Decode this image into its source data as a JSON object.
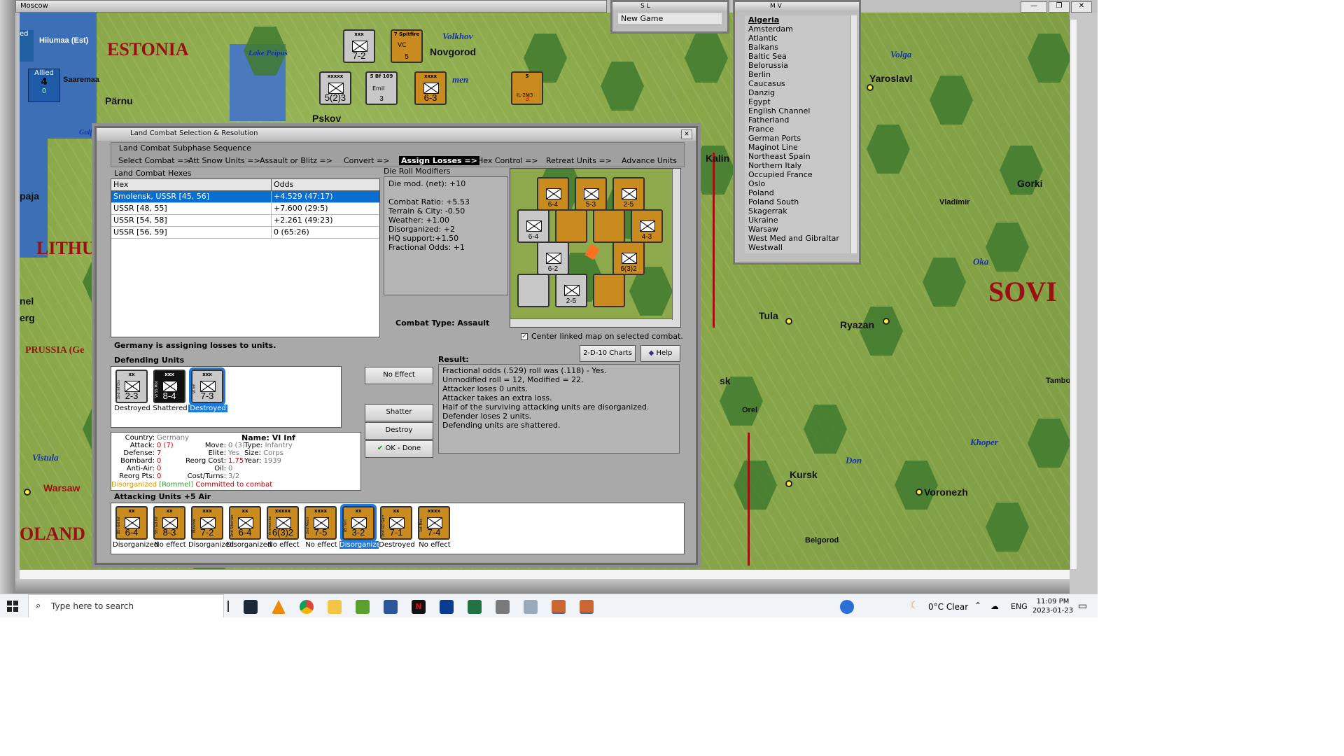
{
  "window": {
    "title": "Moscow"
  },
  "sl_window": {
    "title": "S L",
    "new_game": "New Game"
  },
  "mv_window": {
    "title": "M V",
    "items": [
      "Algeria",
      "Amsterdam",
      "Atlantic",
      "Balkans",
      "Baltic Sea",
      "Belorussia",
      "Berlin",
      "Caucasus",
      "Danzig",
      "Egypt",
      "English Channel",
      "Fatherland",
      "France",
      "German Ports",
      "Maginot Line",
      "Northeast Spain",
      "Northern Italy",
      "Occupied France",
      "Oslo",
      "Poland",
      "Poland South",
      "Skagerrak",
      "Ukraine",
      "Warsaw",
      "West Med and Gibraltar",
      "Westwall"
    ]
  },
  "map": {
    "allied_box": {
      "label": "Allied",
      "value": "4",
      "sub": "0"
    },
    "ed_label": "ed",
    "countries": [
      "ESTONIA",
      "LITHU",
      "SOVI",
      "PRUSSIA (Ge",
      "OLAND"
    ],
    "towns": [
      "Hiiumaa (Est)",
      "Saaremaa",
      "Pärnu",
      "Pskov",
      "Novgorod",
      "Yaroslavl",
      "Kalin",
      "Gorki",
      "Vladimir",
      "Tula",
      "Ryazan",
      "Orel",
      "Kursk",
      "Voronezh",
      "Belgorod",
      "Warsaw",
      "paja",
      "nel",
      "erg",
      "sk",
      "Tambo",
      "Lake Peipus",
      "Gulf"
    ],
    "rivers": [
      "Volkhov",
      "Volga",
      "Oka",
      "Khoper",
      "Don",
      "Vistula",
      "men"
    ],
    "counters": [
      {
        "top": "xxx",
        "mid": "M",
        "str": "7-2"
      },
      {
        "top": "7 Spitfire",
        "mid": "VC",
        "str": "5"
      },
      {
        "top": "xxxxx",
        "mid": "",
        "str": "5(2)3"
      },
      {
        "top": "5 Bf 109",
        "mid": "Emil",
        "str": "3"
      },
      {
        "top": "xxxx",
        "mid": "",
        "str": "6-3"
      },
      {
        "top": "5",
        "mid": "IL-2M3",
        "str": "3"
      }
    ]
  },
  "dialog": {
    "title": "Land Combat Selection & Resolution",
    "subphase_title": "Land Combat Subphase Sequence",
    "sequence": [
      "Select Combat =>",
      "Att Snow Units =>",
      "Assault or Blitz =>",
      "Convert =>",
      "Assign Losses =>",
      "Hex Control =>",
      "Retreat Units =>",
      "Advance Units"
    ],
    "active_step": "Assign Losses =>",
    "hexes_title": "Land Combat Hexes",
    "hex_cols": [
      "Hex",
      "Odds"
    ],
    "hex_rows": [
      {
        "hex": "Smolensk, USSR [45, 56]",
        "odds": "+4.529 (47:17)"
      },
      {
        "hex": "USSR [48, 55]",
        "odds": "+7.600 (29:5)"
      },
      {
        "hex": "USSR [54, 58]",
        "odds": "+2.261 (49:23)"
      },
      {
        "hex": "USSR [56, 59]",
        "odds": "0 (65:26)"
      }
    ],
    "drm_title": "Die Roll Modifiers",
    "drm_lines": [
      "Die mod. (net): +10",
      "",
      "Combat Ratio: +5.53",
      "Terrain & City: -0.50",
      "Weather: +1.00",
      "Disorganized: +2",
      "HQ support:+1.50",
      "Fractional Odds: +1"
    ],
    "combat_type": "Combat Type:  Assault",
    "center_linked": "Center linked map on selected combat.",
    "charts_btn": "2-D-10 Charts",
    "help_btn": "Help",
    "status": "Germany is assigning losses to units.",
    "defending_title": "Defending Units",
    "defenders": [
      {
        "id": "2nd Inf Div",
        "size": "xx",
        "str": "2-3",
        "status": "Destroyed",
        "bg": "#c8c8c8"
      },
      {
        "id": "VI SS Mot",
        "size": "xxx",
        "str": "8-4",
        "status": "Shattered",
        "bg": "#111111"
      },
      {
        "id": "VI Inf",
        "size": "xxx",
        "str": "7-3",
        "status": "Destroyed",
        "bg": "#c8c8c8"
      }
    ],
    "result_title": "Result:",
    "result_lines": [
      "Fractional odds (.529) roll was (.118)  - Yes.",
      "Unmodified roll = 12, Modified = 22.",
      "Attacker loses 0 units.",
      "Attacker takes an extra loss.",
      "Half of the surviving attacking units are disorganized.",
      "Defender loses 2 units.",
      "Defending units are shattered."
    ],
    "buttons": {
      "no_effect": "No Effect",
      "shatter": "Shatter",
      "destroy": "Destroy",
      "ok": "OK - Done"
    },
    "unit_info": {
      "country_label": "Country:",
      "country": "Germany",
      "attack_label": "Attack:",
      "attack": "0 (7)",
      "defense_label": "Defense:",
      "defense": "7",
      "bombard_label": "Bombard:",
      "bombard": "0",
      "antiair_label": "Anti-Air:",
      "antiair": "0",
      "reorg_label": "Reorg Pts:",
      "reorg": "0",
      "name_label": "Name:",
      "name": "VI Inf",
      "move_label": "Move:",
      "move": "0 (3)",
      "type_label": "Type:",
      "type": "Infantry",
      "elite_label": "Elite:",
      "elite": "Yes",
      "size_label": "Size:",
      "size": "Corps",
      "reorgcost_label": "Reorg Cost:",
      "reorgcost": "1.75",
      "year_label": "Year:",
      "year": "1939",
      "oil_label": "Oil:",
      "oil": "0",
      "cost_label": "Cost/Turns:",
      "cost": "3/2",
      "flags_disorg": "Disorganized",
      "flags_rommel": "[Rommel]",
      "flags_committed": "Committed to combat"
    },
    "attacking_title": "Attacking Units +5 Air",
    "attackers": [
      {
        "id": "8th Gd Inf",
        "size": "xx",
        "str": "6-4",
        "status": "Disorganized"
      },
      {
        "id": "5th Gd Inf",
        "size": "xx",
        "str": "8-3",
        "status": "No effect"
      },
      {
        "id": "Moscow",
        "size": "xxx",
        "str": "7-2",
        "status": "Disorganized"
      },
      {
        "id": "2nd Siberian",
        "size": "xx",
        "str": "6-4",
        "status": "Disorganized"
      },
      {
        "id": "Yeremenko",
        "size": "xxxxx",
        "str": "6(3)2",
        "status": "No effect"
      },
      {
        "id": "2nd Mech",
        "size": "xxxx",
        "str": "7-5",
        "status": "No effect"
      },
      {
        "id": "85 mm",
        "size": "xx",
        "str": "3-2",
        "status": "Disorganized"
      },
      {
        "id": "2nd GD Garr",
        "size": "xx",
        "str": "7-1",
        "status": "Destroyed"
      },
      {
        "id": "1st Mot",
        "size": "xxxx",
        "str": "7-4",
        "status": "No effect"
      }
    ]
  },
  "taskbar": {
    "search_placeholder": "Type here to search",
    "weather": "0°C  Clear",
    "lang": "ENG",
    "time": "11:09 PM",
    "date": "2023-01-23"
  }
}
